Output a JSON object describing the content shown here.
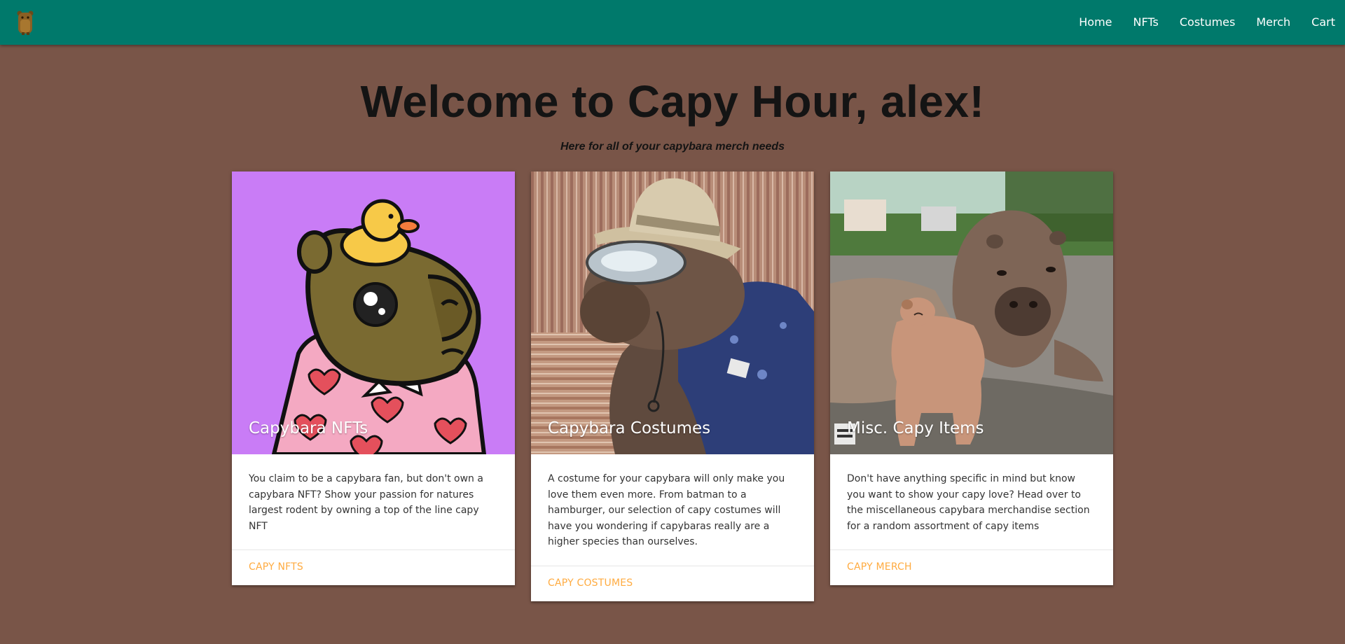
{
  "nav": {
    "logo": "capybara-logo",
    "links": [
      "Home",
      "NFTs",
      "Costumes",
      "Merch",
      "Cart"
    ]
  },
  "hero": {
    "title": "Welcome to Capy Hour, alex!",
    "subtitle": "Here for all of your capybara merch needs"
  },
  "cards": [
    {
      "title": "Capybara NFTs",
      "text": "You claim to be a capybara fan, but don't own a capybara NFT? Show your passion for natures largest rodent by owning a top of the line capy NFT",
      "action": "Capy NFTs"
    },
    {
      "title": "Capybara Costumes",
      "text": "A costume for your capybara will only make you love them even more. From batman to a hamburger, our selection of capy costumes will have you wondering if capybaras really are a higher species than ourselves.",
      "action": "Capy Costumes"
    },
    {
      "title": "Misc. Capy Items",
      "text": "Don't have anything specific in mind but know you want to show your capy love? Head over to the miscellaneous capybara merchandise section for a random assortment of capy items",
      "action": "Capy Merch"
    }
  ],
  "colors": {
    "navbar": "#00796b",
    "background": "#795548",
    "action": "#ffab40"
  }
}
